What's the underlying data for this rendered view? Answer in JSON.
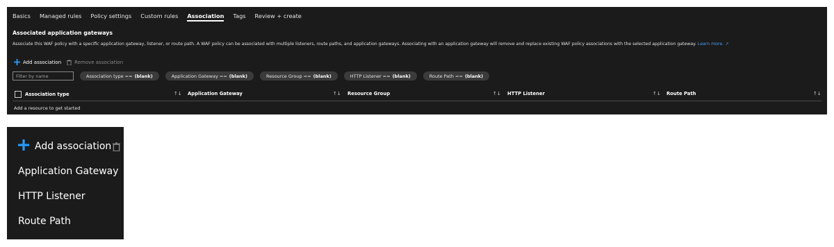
{
  "tabs": [
    "Basics",
    "Managed rules",
    "Policy settings",
    "Custom rules",
    "Association",
    "Tags",
    "Review + create"
  ],
  "active_tab": "Association",
  "section": {
    "title": "Associated application gateways",
    "description": "Associate this WAF policy with a specific application gateway, listener, or route path. A WAF policy can be associated with multiple listeners, route paths, and application gateways. Associating with an application gateway will remove and replace existing WAF policy associations with the selected application gateway.",
    "learn_more": "Learn more."
  },
  "toolbar": {
    "add_label": "Add association",
    "remove_label": "Remove association",
    "add_icon": "plus-icon",
    "remove_icon": "trash-icon"
  },
  "filter": {
    "placeholder": "Filter by name",
    "pills": [
      {
        "label": "Association type ==",
        "value": "(blank)"
      },
      {
        "label": "Application Gateway ==",
        "value": "(blank)"
      },
      {
        "label": "Resource Group ==",
        "value": "(blank)"
      },
      {
        "label": "HTTP Listener ==",
        "value": "(blank)"
      },
      {
        "label": "Route Path ==",
        "value": "(blank)"
      }
    ]
  },
  "table": {
    "columns": [
      "Association type",
      "Application Gateway",
      "Resource Group",
      "HTTP Listener",
      "Route Path"
    ],
    "sort_glyph": "↑↓",
    "empty_message": "Add a resource to get started"
  },
  "zoom_menu": {
    "add_label": "Add association",
    "items": [
      "Application Gateway",
      "HTTP Listener",
      "Route Path"
    ]
  },
  "colors": {
    "background": "#1b1b1b",
    "accent": "#479ef5",
    "plus": "#2899f5",
    "pill": "#3b3b3b"
  }
}
